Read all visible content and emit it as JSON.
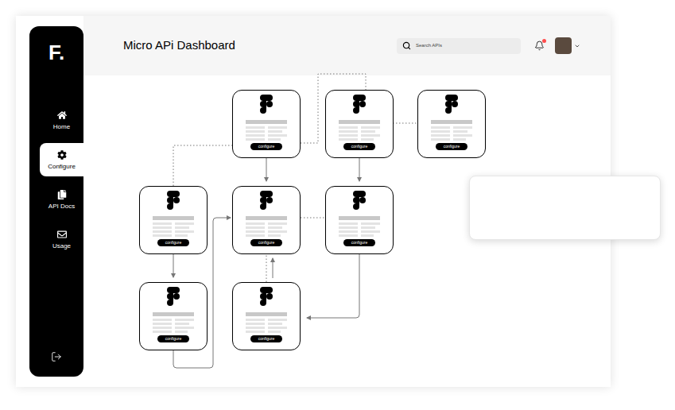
{
  "header": {
    "title": "Micro APi Dashboard",
    "search": {
      "placeholder": "Search APIs"
    },
    "notifications": {
      "unread": true
    }
  },
  "sidebar": {
    "logo": "F.",
    "items": [
      {
        "label": "Home",
        "selected": false
      },
      {
        "label": "Configure",
        "selected": true
      },
      {
        "label": "API Docs",
        "selected": false
      },
      {
        "label": "Usage",
        "selected": false
      }
    ]
  },
  "diagram": {
    "nodes": [
      {
        "button": "configure"
      },
      {
        "button": "configure"
      },
      {
        "button": "configure"
      },
      {
        "button": "configure"
      },
      {
        "button": "configure"
      },
      {
        "button": "configure"
      },
      {
        "button": "configure"
      },
      {
        "button": "configure"
      }
    ]
  }
}
